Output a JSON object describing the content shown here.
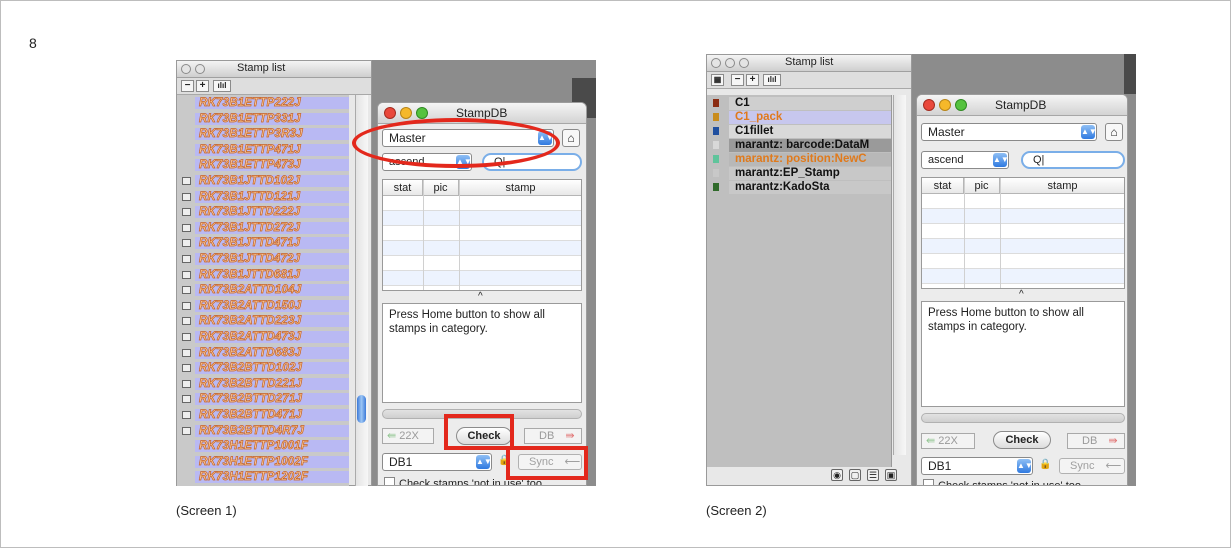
{
  "page": {
    "number": "8"
  },
  "captions": {
    "screen1": "(Screen 1)",
    "screen2": "(Screen 2)"
  },
  "stamp_list": {
    "title": "Stamp list",
    "toolbar": {
      "minus": "−",
      "plus": "+",
      "chart": "ılıl"
    },
    "screen1_items": [
      "RK73B1ETTP222J",
      "RK73B1ETTP331J",
      "RK73B1ETTP3R3J",
      "RK73B1ETTP471J",
      "RK73B1ETTP473J",
      "RK73B1JTTD102J",
      "RK73B1JTTD121J",
      "RK73B1JTTD222J",
      "RK73B1JTTD272J",
      "RK73B1JTTD471J",
      "RK73B1JTTD472J",
      "RK73B1JTTD681J",
      "RK73B2ATTD104J",
      "RK73B2ATTD150J",
      "RK73B2ATTD223J",
      "RK73B2ATTD473J",
      "RK73B2ATTD683J",
      "RK73B2BTTD102J",
      "RK73B2BTTD221J",
      "RK73B2BTTD271J",
      "RK73B2BTTD471J",
      "RK73B2BTTD4R7J",
      "RK73H1ETTP1001F",
      "RK73H1ETTP1002F",
      "RK73H1ETTP1202F"
    ],
    "screen1_tagged": [
      5,
      6,
      7,
      8,
      9,
      10,
      11,
      12,
      13,
      14,
      15,
      16,
      17,
      18,
      19,
      20,
      21
    ],
    "screen2_items": [
      {
        "text": "C1",
        "color": "#111111",
        "band": "#cfcfcf",
        "icon": "#8a2b12"
      },
      {
        "text": "C1_pack",
        "color": "#e07a1c",
        "band": "#c7c7ee",
        "icon": "#c98c1b"
      },
      {
        "text": "C1fillet",
        "color": "#111111",
        "band": "#d9d9d9",
        "icon": "#1f4f9f"
      },
      {
        "text": "marantz: barcode:DataM",
        "color": "#111111",
        "band": "#9a9a9a",
        "icon": "#d8d8d8"
      },
      {
        "text": "marantz: position:NewC",
        "color": "#e07a1c",
        "band": "#b8b8b8",
        "icon": "#5fc49b"
      },
      {
        "text": "marantz:EP_Stamp",
        "color": "#111111",
        "band": "#c8c8c8",
        "icon": "#c8c8c8"
      },
      {
        "text": "marantz:KadoSta",
        "color": "#111111",
        "band": "#c8c8c8",
        "icon": "#2f6a2a"
      }
    ],
    "screen2_bottom_icons": [
      "◉",
      "▢",
      "☰",
      "▣"
    ]
  },
  "stampdb": {
    "title": "StampDB",
    "category": "Master",
    "home_icon": "⌂",
    "sort": "ascend",
    "search_placeholder": "Q|",
    "columns": [
      "stat",
      "pic",
      "stamp"
    ],
    "scroll_marker": "^",
    "message": "Press Home button to show all stamps in category.",
    "prev_label": "22X",
    "check_label": "Check",
    "next_label": "DB",
    "db_select": "DB1",
    "sync_label": "Sync",
    "check_stamps": "Check stamps 'not in use' too"
  },
  "colors": {
    "highlight": "#e3281c",
    "row_blue": "#b9b9f3",
    "row_stroke": "#c8621f"
  }
}
